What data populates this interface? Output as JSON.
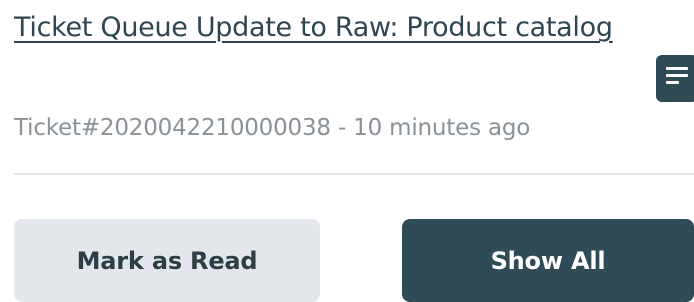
{
  "notification": {
    "title": "Ticket Queue Update to Raw: Product catalog",
    "meta": "Ticket#2020042210000038 - 10 minutes ago",
    "icon": "document-lines-icon"
  },
  "actions": {
    "mark_read_label": "Mark as Read",
    "show_all_label": "Show All"
  },
  "colors": {
    "title_text": "#2f4650",
    "meta_text": "#8a9197",
    "primary_button": "#2f4b56",
    "secondary_button": "#e3e7ec",
    "divider": "#e4e6e8"
  }
}
